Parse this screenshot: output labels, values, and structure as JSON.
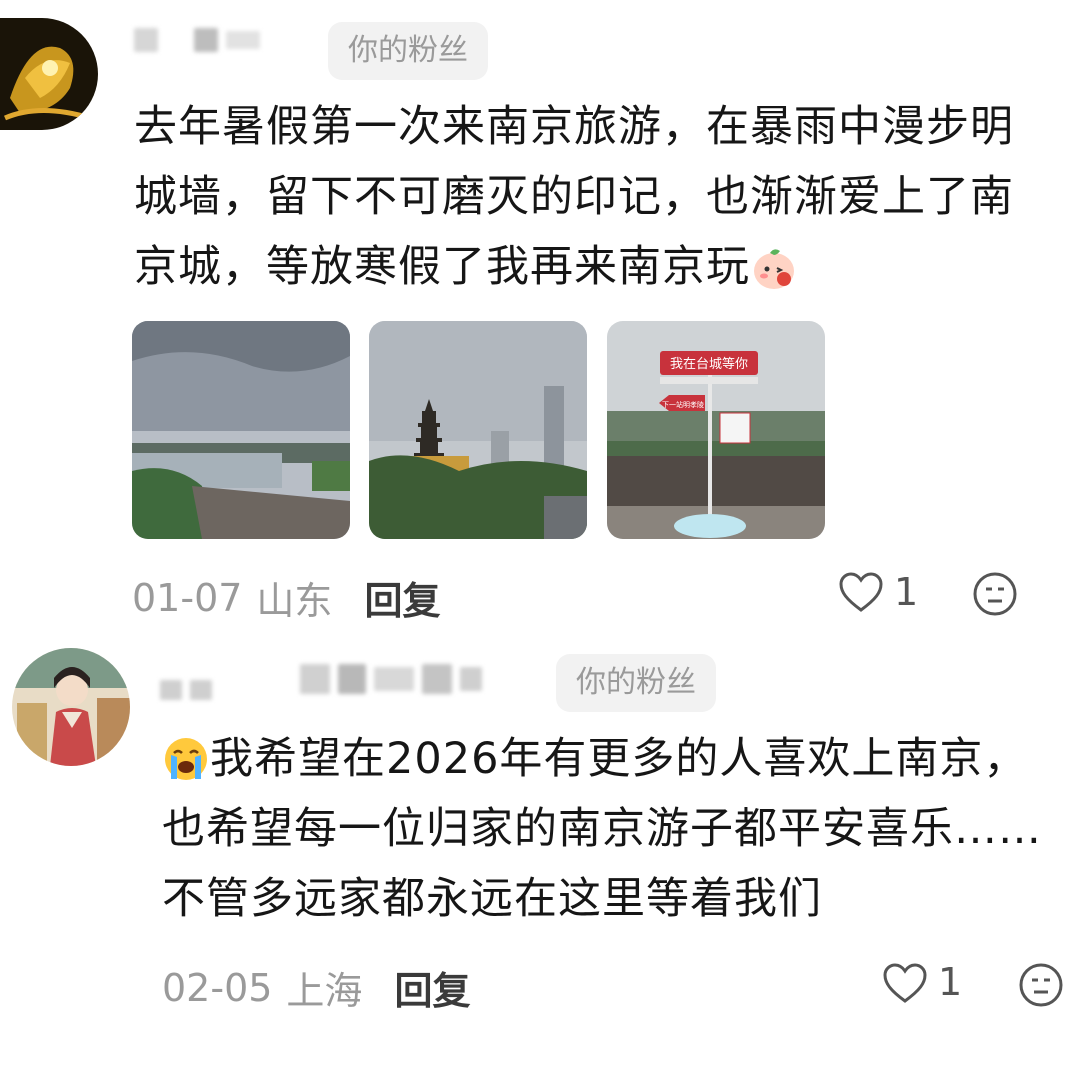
{
  "comments": [
    {
      "badge": "你的粉丝",
      "text_before_emoji": "去年暑假第一次来南京旅游，在暴雨中漫步明城墙，留下不可磨灭的印记，也渐渐爱上了南京城，等放寒假了我再来南京玩",
      "emoji": "peach-face-emoji",
      "images": [
        {
          "name": "photo-lake-city-wall"
        },
        {
          "name": "photo-pagoda-skyline"
        },
        {
          "name": "photo-sign-on-wall",
          "sign_text": "我在台城等你",
          "sub_sign_text": "下一站明孝陵"
        }
      ],
      "date": "01-07",
      "location": "山东",
      "reply_label": "回复",
      "likes": "1"
    },
    {
      "badge": "你的粉丝",
      "emoji": "crying-face-emoji",
      "text": "我希望在2026年有更多的人喜欢上南京，也希望每一位归家的南京游子都平安喜乐……不管多远家都永远在这里等着我们",
      "date": "02-05",
      "location": "上海",
      "reply_label": "回复",
      "likes": "1"
    }
  ],
  "colors": {
    "badge_bg": "#f2f2f2",
    "meta_gray": "#9a9a9a",
    "text": "#161616"
  }
}
